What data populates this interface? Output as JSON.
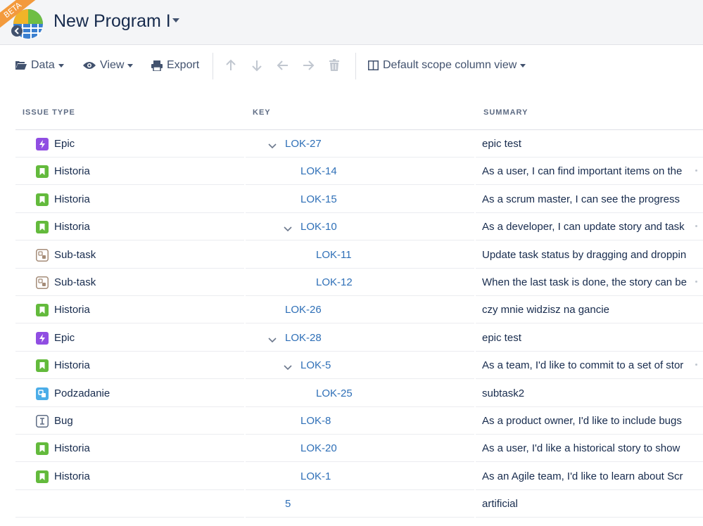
{
  "header": {
    "badge": "BETA",
    "title": "New Program I"
  },
  "toolbar": {
    "data_label": "Data",
    "view_label": "View",
    "export_label": "Export",
    "scope_view_label": "Default scope column view"
  },
  "columns": {
    "issue_type": "ISSUE TYPE",
    "key": "KEY",
    "summary": "SUMMARY"
  },
  "rows": [
    {
      "type": "Epic",
      "icon": "epic-icon",
      "key": "LOK-27",
      "level": 0,
      "expandable": true,
      "summary": "epic test",
      "more": false
    },
    {
      "type": "Historia",
      "icon": "story-icon",
      "key": "LOK-14",
      "level": 1,
      "expandable": false,
      "summary": "As a user, I can find important items on the",
      "more": true
    },
    {
      "type": "Historia",
      "icon": "story-icon",
      "key": "LOK-15",
      "level": 1,
      "expandable": false,
      "summary": "As a scrum master, I can see the progress",
      "more": false
    },
    {
      "type": "Historia",
      "icon": "story-icon",
      "key": "LOK-10",
      "level": 1,
      "expandable": true,
      "summary": "As a developer, I can update story and task",
      "more": true
    },
    {
      "type": "Sub-task",
      "icon": "subtask-icon",
      "key": "LOK-11",
      "level": 2,
      "expandable": false,
      "summary": "Update task status by dragging and droppin",
      "more": false
    },
    {
      "type": "Sub-task",
      "icon": "subtask-icon",
      "key": "LOK-12",
      "level": 2,
      "expandable": false,
      "summary": "When the last task is done, the story can be",
      "more": true
    },
    {
      "type": "Historia",
      "icon": "story-icon",
      "key": "LOK-26",
      "level": 0,
      "expandable": false,
      "summary": "czy mnie widzisz na gancie",
      "more": false
    },
    {
      "type": "Epic",
      "icon": "epic-icon",
      "key": "LOK-28",
      "level": 0,
      "expandable": true,
      "summary": "epic test",
      "more": false
    },
    {
      "type": "Historia",
      "icon": "story-icon",
      "key": "LOK-5",
      "level": 1,
      "expandable": true,
      "summary": "As a team, I'd like to commit to a set of stor",
      "more": true
    },
    {
      "type": "Podzadanie",
      "icon": "podzadanie-icon",
      "key": "LOK-25",
      "level": 2,
      "expandable": false,
      "summary": "subtask2",
      "more": false
    },
    {
      "type": "Bug",
      "icon": "bug-icon",
      "key": "LOK-8",
      "level": 1,
      "expandable": false,
      "summary": "As a product owner, I'd like to include bugs",
      "more": false
    },
    {
      "type": "Historia",
      "icon": "story-icon",
      "key": "LOK-20",
      "level": 1,
      "expandable": false,
      "summary": "As a user, I'd like a historical story to show",
      "more": false
    },
    {
      "type": "Historia",
      "icon": "story-icon",
      "key": "LOK-1",
      "level": 1,
      "expandable": false,
      "summary": "As an Agile team, I'd like to learn about Scr",
      "more": false
    },
    {
      "type": "",
      "icon": "",
      "key": "5",
      "level": 0,
      "expandable": false,
      "summary": "artificial",
      "more": false
    }
  ],
  "colors": {
    "epic": "#904ee2",
    "story": "#63ba3c",
    "subtask": "#a58c78",
    "podzadanie": "#4bade8",
    "bug": "#5e6c84",
    "link": "#2e6fb7",
    "badge": "#f39a3c"
  }
}
